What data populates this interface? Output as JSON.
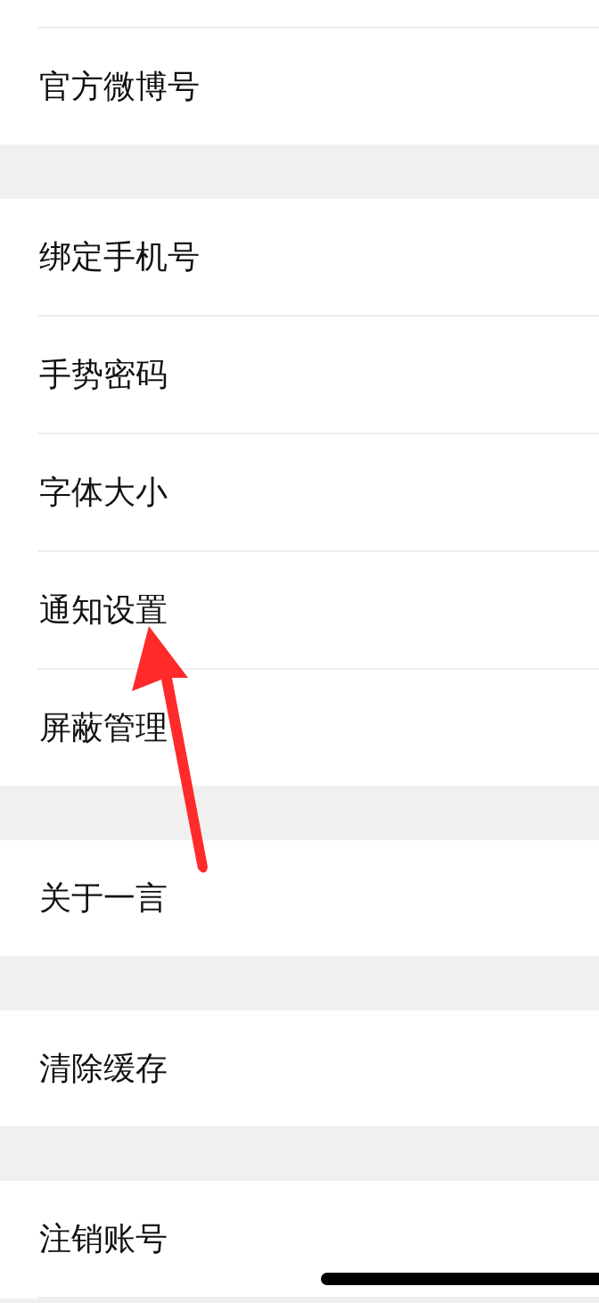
{
  "groups": [
    {
      "items": [
        {
          "label": "官方微博号"
        }
      ],
      "leading_divider": true
    },
    {
      "items": [
        {
          "label": "绑定手机号"
        },
        {
          "label": "手势密码"
        },
        {
          "label": "字体大小"
        },
        {
          "label": "通知设置"
        },
        {
          "label": "屏蔽管理"
        }
      ]
    },
    {
      "items": [
        {
          "label": "关于一言"
        }
      ]
    },
    {
      "items": [
        {
          "label": "清除缓存"
        }
      ]
    },
    {
      "items": [
        {
          "label": "注销账号"
        }
      ],
      "trailing_divider": true
    }
  ]
}
